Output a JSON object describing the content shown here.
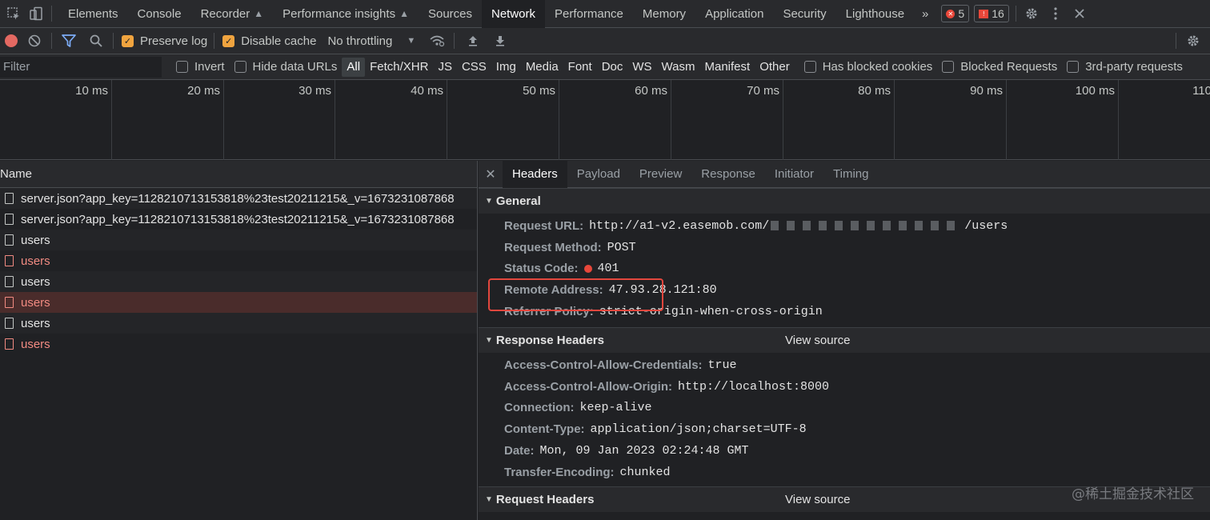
{
  "tabbar": {
    "tabs": [
      {
        "label": "Elements",
        "active": false,
        "experimental": false
      },
      {
        "label": "Console",
        "active": false,
        "experimental": false
      },
      {
        "label": "Recorder",
        "active": false,
        "experimental": true
      },
      {
        "label": "Performance insights",
        "active": false,
        "experimental": true
      },
      {
        "label": "Sources",
        "active": false,
        "experimental": false
      },
      {
        "label": "Network",
        "active": true,
        "experimental": false
      },
      {
        "label": "Performance",
        "active": false,
        "experimental": false
      },
      {
        "label": "Memory",
        "active": false,
        "experimental": false
      },
      {
        "label": "Application",
        "active": false,
        "experimental": false
      },
      {
        "label": "Security",
        "active": false,
        "experimental": false
      },
      {
        "label": "Lighthouse",
        "active": false,
        "experimental": false
      }
    ],
    "more": "»",
    "errors_count": "5",
    "warnings_count": "16"
  },
  "toolbar": {
    "preserve_log": "Preserve log",
    "disable_cache": "Disable cache",
    "throttling": "No throttling"
  },
  "filterbar": {
    "filter_placeholder": "Filter",
    "invert": "Invert",
    "hide_data_urls": "Hide data URLs",
    "types": [
      "All",
      "Fetch/XHR",
      "JS",
      "CSS",
      "Img",
      "Media",
      "Font",
      "Doc",
      "WS",
      "Wasm",
      "Manifest",
      "Other"
    ],
    "selected_type": "All",
    "has_blocked_cookies": "Has blocked cookies",
    "blocked_requests": "Blocked Requests",
    "third_party": "3rd-party requests"
  },
  "overview": {
    "ticks": [
      "10 ms",
      "20 ms",
      "30 ms",
      "40 ms",
      "50 ms",
      "60 ms",
      "70 ms",
      "80 ms",
      "90 ms",
      "100 ms",
      "110"
    ]
  },
  "requests": {
    "header": "Name",
    "rows": [
      {
        "name": "server.json?app_key=1128210713153818%23test20211215&_v=1673231087868",
        "error": false,
        "selected": false
      },
      {
        "name": "server.json?app_key=1128210713153818%23test20211215&_v=1673231087868",
        "error": false,
        "selected": false
      },
      {
        "name": "users",
        "error": false,
        "selected": false
      },
      {
        "name": "users",
        "error": true,
        "selected": false
      },
      {
        "name": "users",
        "error": false,
        "selected": false
      },
      {
        "name": "users",
        "error": true,
        "selected": true
      },
      {
        "name": "users",
        "error": false,
        "selected": false
      },
      {
        "name": "users",
        "error": true,
        "selected": false
      }
    ]
  },
  "detail": {
    "tabs": [
      "Headers",
      "Payload",
      "Preview",
      "Response",
      "Initiator",
      "Timing"
    ],
    "active_tab": "Headers",
    "general": {
      "title": "General",
      "request_url_key": "Request URL:",
      "request_url_prefix": "http://a1-v2.easemob.com/",
      "request_url_suffix": "/users",
      "request_method_key": "Request Method:",
      "request_method": "POST",
      "status_code_key": "Status Code:",
      "status_code": "401",
      "remote_address_key": "Remote Address:",
      "remote_address": "47.93.28.121:80",
      "referrer_policy_key": "Referrer Policy:",
      "referrer_policy": "strict-origin-when-cross-origin"
    },
    "response_headers": {
      "title": "Response Headers",
      "view_source": "View source",
      "items": [
        {
          "key": "Access-Control-Allow-Credentials:",
          "value": "true"
        },
        {
          "key": "Access-Control-Allow-Origin:",
          "value": "http://localhost:8000"
        },
        {
          "key": "Connection:",
          "value": "keep-alive"
        },
        {
          "key": "Content-Type:",
          "value": "application/json;charset=UTF-8"
        },
        {
          "key": "Date:",
          "value": "Mon, 09 Jan 2023 02:24:48 GMT"
        },
        {
          "key": "Transfer-Encoding:",
          "value": "chunked"
        }
      ]
    },
    "request_headers": {
      "title": "Request Headers",
      "view_source": "View source"
    }
  },
  "watermark": "@稀土掘金技术社区",
  "colors": {
    "accent_checkbox": "#f0a43f",
    "error_text": "#f28b82",
    "highlight_box": "#e2473e",
    "record": "#e46962"
  }
}
